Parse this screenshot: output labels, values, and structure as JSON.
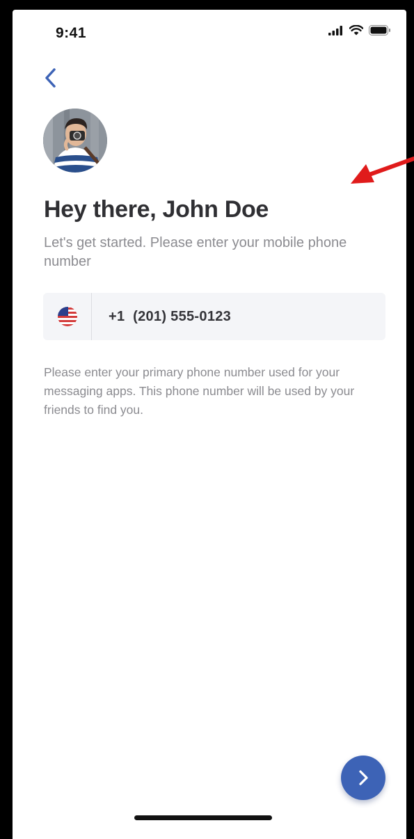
{
  "status_bar": {
    "time": "9:41",
    "icons": [
      "cellular-signal-icon",
      "wifi-icon",
      "battery-icon"
    ]
  },
  "navigation": {
    "back_icon": "chevron-left-icon"
  },
  "profile": {
    "avatar": "user-photo-avatar"
  },
  "header": {
    "title": "Hey there, John Doe",
    "subtitle": "Let's get started. Please enter your mobile phone number"
  },
  "phone_field": {
    "country_flag": "us-flag-icon",
    "value": "+1  (201) 555-0123"
  },
  "help_text": "Please enter your primary phone number used for your messaging apps. This phone number will be used by your friends to find you.",
  "next_button": {
    "icon": "chevron-right-icon"
  },
  "colors": {
    "accent": "#3d63b6",
    "title": "#2f2f33",
    "muted": "#8b8b90",
    "field_bg": "#f4f5f8",
    "annotation": "#e01b1b"
  }
}
